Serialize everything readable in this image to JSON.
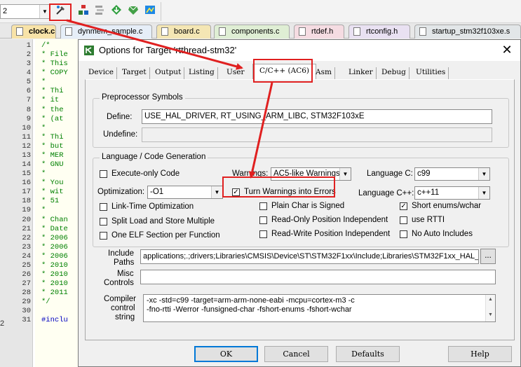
{
  "toolbar": {
    "combo_value": "2",
    "icons": [
      "target-options-icon",
      "manage-project-items-icon",
      "select-packs-icon",
      "pack-installer-icon",
      "green-diamond-icon",
      "device-database-icon"
    ]
  },
  "file_tabs": [
    {
      "label": "clock.c",
      "active": true
    },
    {
      "label": "dynmem_sample.c",
      "active": false
    },
    {
      "label": "board.c",
      "active": false
    },
    {
      "label": "components.c",
      "active": false
    },
    {
      "label": "rtdef.h",
      "active": false
    },
    {
      "label": "rtconfig.h",
      "active": false
    },
    {
      "label": "startup_stm32f103xe.s",
      "active": false
    }
  ],
  "editor": {
    "lines": [
      {
        "n": "1",
        "t": "/*"
      },
      {
        "n": "2",
        "t": " * File"
      },
      {
        "n": "3",
        "t": " * This"
      },
      {
        "n": "4",
        "t": " * COPY"
      },
      {
        "n": "5",
        "t": " *"
      },
      {
        "n": "6",
        "t": " *  Thi"
      },
      {
        "n": "7",
        "t": " *  it"
      },
      {
        "n": "8",
        "t": " *  the"
      },
      {
        "n": "9",
        "t": " *  (at"
      },
      {
        "n": "10",
        "t": " *"
      },
      {
        "n": "11",
        "t": " *  Thi"
      },
      {
        "n": "12",
        "t": " *  but"
      },
      {
        "n": "13",
        "t": " *  MER"
      },
      {
        "n": "14",
        "t": " *  GNU"
      },
      {
        "n": "15",
        "t": " *"
      },
      {
        "n": "16",
        "t": " *  You"
      },
      {
        "n": "17",
        "t": " *  wit"
      },
      {
        "n": "18",
        "t": " *  51"
      },
      {
        "n": "19",
        "t": " *"
      },
      {
        "n": "20",
        "t": " * Chan"
      },
      {
        "n": "21",
        "t": " * Date"
      },
      {
        "n": "22",
        "t": " * 2006"
      },
      {
        "n": "23",
        "t": " * 2006"
      },
      {
        "n": "24",
        "t": " * 2006"
      },
      {
        "n": "25",
        "t": " * 2010"
      },
      {
        "n": "26",
        "t": " * 2010"
      },
      {
        "n": "27",
        "t": " * 2010"
      },
      {
        "n": "28",
        "t": " * 2011"
      },
      {
        "n": "29",
        "t": " */"
      },
      {
        "n": "30",
        "t": ""
      },
      {
        "n": "31",
        "t": "#inclu"
      }
    ]
  },
  "dialog": {
    "title": "Options for Target 'rtthread-stm32'",
    "close_glyph": "✕",
    "tabs": [
      {
        "label": "Device",
        "active": false
      },
      {
        "label": "Target",
        "active": false
      },
      {
        "label": "Output",
        "active": false
      },
      {
        "label": "Listing",
        "active": false
      },
      {
        "label": "User",
        "active": false
      },
      {
        "label": "C/C++ (AC6)",
        "active": true
      },
      {
        "label": "Asm",
        "active": false
      },
      {
        "label": "Linker",
        "active": false
      },
      {
        "label": "Debug",
        "active": false
      },
      {
        "label": "Utilities",
        "active": false
      }
    ],
    "preprocessor": {
      "group_label": "Preprocessor Symbols",
      "define_label": "Define:",
      "define_value": "USE_HAL_DRIVER, RT_USING_ARM_LIBC, STM32F103xE",
      "undefine_label": "Undefine:",
      "undefine_value": ""
    },
    "codegen": {
      "group_label": "Language / Code Generation",
      "execute_only": {
        "label": "Execute-only Code",
        "checked": false
      },
      "warnings_label": "Warnings:",
      "warnings_value": "AC5-like Warnings",
      "language_c_label": "Language C:",
      "language_c_value": "c99",
      "optimization_label": "Optimization:",
      "optimization_value": "-O1",
      "turn_warnings": {
        "label": "Turn Warnings into Errors",
        "checked": true
      },
      "language_cpp_label": "Language C++:",
      "language_cpp_value": "c++11",
      "link_time": {
        "label": "Link-Time Optimization",
        "checked": false
      },
      "plain_char": {
        "label": "Plain Char is Signed",
        "checked": false
      },
      "short_enums": {
        "label": "Short enums/wchar",
        "checked": true
      },
      "split_load": {
        "label": "Split Load and Store Multiple",
        "checked": false
      },
      "ropi": {
        "label": "Read-Only Position Independent",
        "checked": false
      },
      "rtti": {
        "label": "use RTTI",
        "checked": false
      },
      "one_elf": {
        "label": "One ELF Section per Function",
        "checked": false
      },
      "rwpi": {
        "label": "Read-Write Position Independent",
        "checked": false
      },
      "no_auto_includes": {
        "label": "No Auto Includes",
        "checked": false
      }
    },
    "include_label_1": "Include",
    "include_label_2": "Paths",
    "include_value": "applications;.;drivers;Libraries\\CMSIS\\Device\\ST\\STM32F1xx\\Include;Libraries\\STM32F1xx_HAL_D",
    "browse_label": "...",
    "misc_label_1": "Misc",
    "misc_label_2": "Controls",
    "misc_value": "",
    "compiler_label_1": "Compiler",
    "compiler_label_2": "control",
    "compiler_label_3": "string",
    "compiler_line_1": "-xc -std=c99 -target=arm-arm-none-eabi -mcpu=cortex-m3 -c",
    "compiler_line_2": "-fno-rtti -Werror -funsigned-char -fshort-enums -fshort-wchar",
    "buttons": {
      "ok": "OK",
      "cancel": "Cancel",
      "defaults": "Defaults",
      "help": "Help"
    }
  },
  "annotation_color": "#e02020"
}
